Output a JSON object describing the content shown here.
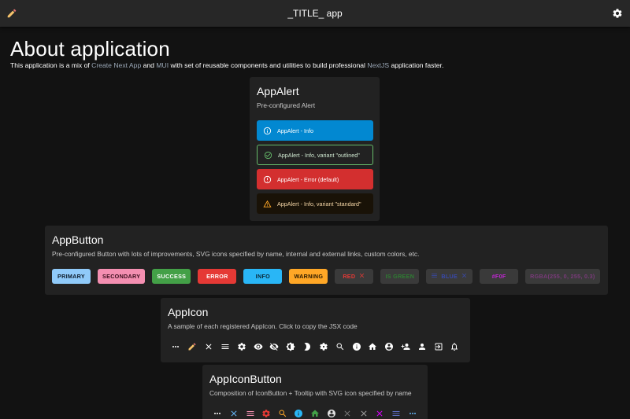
{
  "appbar": {
    "title": "_TITLE_ app",
    "left_icon": "pencil-icon",
    "right_icon": "gear-icon"
  },
  "page": {
    "title": "About application",
    "intro_before": "This application is a mix of ",
    "link_cna": "Create Next App",
    "intro_and": " and ",
    "link_mui": "MUI",
    "intro_mid": " with set of reusable components and utilities to build professional ",
    "link_nextjs": "NextJS",
    "intro_after": " application faster."
  },
  "app_alert": {
    "title": "AppAlert",
    "subtitle": "Pre-configured Alert",
    "alerts": [
      {
        "text": "AppAlert - Info",
        "icon": "info-icon",
        "bg": "#0288d1",
        "color": "#ffffff",
        "border": "none"
      },
      {
        "text": "AppAlert - Info, variant \"outlined\"",
        "icon": "check-circle-icon",
        "bg": "transparent",
        "color": "#cfe8d0",
        "border": "#66bb6a"
      },
      {
        "text": "AppAlert - Error (default)",
        "icon": "error-icon",
        "bg": "#d32f2f",
        "color": "#ffffff",
        "border": "none"
      },
      {
        "text": "AppAlert - Info, variant \"standard\"",
        "icon": "warning-icon",
        "bg": "#191207",
        "color": "#f6d7a7",
        "border": "none"
      }
    ]
  },
  "app_button": {
    "title": "AppButton",
    "subtitle": "Pre-configured Button with lots of improvements, SVG icons specified by name, internal and external links, custom colors, etc.",
    "buttons": [
      {
        "label": "PRIMARY",
        "bg": "#90caf9",
        "color": "#0d1b2a"
      },
      {
        "label": "SECONDARY",
        "bg": "#f48fb1",
        "color": "#3a0d1c"
      },
      {
        "label": "SUCCESS",
        "bg": "#43a047",
        "color": "#ffffff"
      },
      {
        "label": "ERROR",
        "bg": "#e53935",
        "color": "#ffffff"
      },
      {
        "label": "INFO",
        "bg": "#29b6f6",
        "color": "#0a2a3a"
      },
      {
        "label": "WARNING",
        "bg": "#ffa726",
        "color": "#2a1a00"
      },
      {
        "label": "RED",
        "bg": "#3a3a3a",
        "color": "#e53935",
        "icon": "close-icon"
      },
      {
        "label": "IS GREEN",
        "bg": "#3a3a3a",
        "color": "#2e7d32"
      },
      {
        "label": "BLUE",
        "bg": "#3a3a3a",
        "color": "#3949ab",
        "icon": "menu-icon",
        "icon_end": "close-icon"
      },
      {
        "label": "#F0F",
        "bg": "#3a3a3a",
        "color": "#c026d3"
      },
      {
        "label": "RGBA(255, 0, 255, 0.3)",
        "bg": "#3a3a3a",
        "color": "#7a3a7a"
      }
    ]
  },
  "app_icon": {
    "title": "AppIcon",
    "subtitle": "A sample of each registered AppIcon. Click to copy the JSX code",
    "icons": [
      "more-horiz-icon",
      "pencil-icon",
      "close-icon",
      "menu-icon",
      "gear-icon",
      "eye-icon",
      "eye-off-icon",
      "brightness-icon",
      "moon-icon",
      "gear-outline-icon",
      "search-icon",
      "info-icon",
      "home-icon",
      "account-circle-icon",
      "person-add-icon",
      "person-icon",
      "logout-icon",
      "bell-icon"
    ]
  },
  "app_icon_button": {
    "title": "AppIconButton",
    "subtitle": "Composition of IconButton + Tooltip with SVG icon specified by name",
    "icons": [
      {
        "name": "more-horiz-icon",
        "color": "#ffffff"
      },
      {
        "name": "close-icon",
        "color": "#64b5f6"
      },
      {
        "name": "menu-icon",
        "color": "#f48fb1"
      },
      {
        "name": "gear-icon",
        "color": "#e53935"
      },
      {
        "name": "search-icon",
        "color": "#ffa726"
      },
      {
        "name": "info-icon",
        "color": "#29b6f6"
      },
      {
        "name": "home-icon",
        "color": "#43a047"
      },
      {
        "name": "account-circle-icon",
        "color": "#e0e0e0"
      },
      {
        "name": "close-icon",
        "color": "#757575"
      },
      {
        "name": "close-icon",
        "color": "#9e9e9e"
      },
      {
        "name": "close-icon",
        "color": "#d500f9"
      },
      {
        "name": "menu-icon",
        "color": "#5c6bc0"
      },
      {
        "name": "more-horiz-icon",
        "color": "#64b5f6"
      }
    ]
  }
}
